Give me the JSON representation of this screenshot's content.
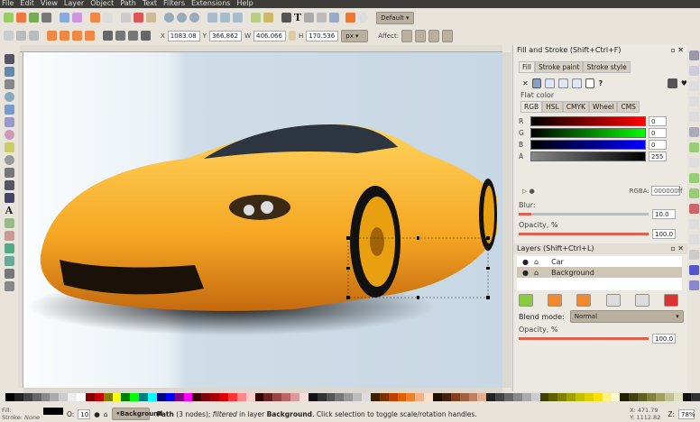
{
  "menu": [
    "File",
    "Edit",
    "View",
    "Layer",
    "Object",
    "Path",
    "Text",
    "Filters",
    "Extensions",
    "Help"
  ],
  "toolbar": {
    "preset": "Default"
  },
  "selection": {
    "x_label": "X",
    "x": "1083.08",
    "y_label": "Y",
    "y": "366.862",
    "w_label": "W",
    "w": "406.066",
    "h_label": "H",
    "h": "170.536",
    "unit": "px",
    "affect_label": "Affect:"
  },
  "fill_stroke": {
    "title": "Fill and Stroke (Shift+Ctrl+F)",
    "tabs": [
      "Fill",
      "Stroke paint",
      "Stroke style"
    ],
    "paint_type": "Flat color",
    "mode_tabs": [
      "RGB",
      "HSL",
      "CMYK",
      "Wheel",
      "CMS"
    ],
    "channels": [
      {
        "label": "R",
        "value": "0",
        "color": "#ff0000"
      },
      {
        "label": "G",
        "value": "0",
        "color": "#00ff00"
      },
      {
        "label": "B",
        "value": "0",
        "color": "#0000ff"
      },
      {
        "label": "A",
        "value": "255",
        "color": "#000000"
      }
    ],
    "rgba_label": "RGBA:",
    "rgba": "000000ff",
    "blur_label": "Blur:",
    "blur": "10.0",
    "blur_fraction": 0.1,
    "opacity_label": "Opacity, %",
    "opacity": "100.0"
  },
  "layers": {
    "title": "Layers (Shift+Ctrl+L)",
    "items": [
      {
        "name": "Car",
        "selected": false
      },
      {
        "name": "Background",
        "selected": true
      }
    ],
    "blend_label": "Blend mode:",
    "blend": "Normal",
    "opacity_label": "Opacity, %",
    "opacity": "100.0"
  },
  "status": {
    "fill_label": "Fill:",
    "stroke_label": "Stroke:",
    "stroke_value": "None",
    "fill_color": "#000000",
    "o_label": "O:",
    "opacity": "10",
    "layer": "•Background",
    "msg_obj": "Path",
    "msg_nodes": " (3 nodes); ",
    "msg_filtered": "filtered",
    "msg_in": " in layer ",
    "msg_layer": "Background",
    "msg_tail": ". Click selection to toggle scale/rotation handles.",
    "cursor_x": "X:  471.79",
    "cursor_y": "Y: 1112.82",
    "zoom_label": "Z:",
    "zoom": "78%"
  },
  "palette": [
    "#000",
    "#222",
    "#444",
    "#666",
    "#888",
    "#aaa",
    "#ccc",
    "#eee",
    "#fff",
    "#800000",
    "#c00",
    "#808000",
    "#ff0",
    "#008000",
    "#0f0",
    "#008080",
    "#0ff",
    "#000080",
    "#00f",
    "#800080",
    "#f0f",
    "#400000",
    "#800010",
    "#a00",
    "#d00",
    "#f33",
    "#f88",
    "#fcc",
    "#300",
    "#622",
    "#944",
    "#b66",
    "#d99",
    "#fdd",
    "#111",
    "#333",
    "#555",
    "#777",
    "#999",
    "#bbb",
    "#ddd",
    "#402000",
    "#803000",
    "#c04000",
    "#e06000",
    "#f08030",
    "#f8b080",
    "#fde0c8",
    "#201000",
    "#402010",
    "#804020",
    "#a06040",
    "#c08060",
    "#e0b090",
    "#222",
    "#444",
    "#666",
    "#888",
    "#aaa",
    "#ccc",
    "#404000",
    "#606000",
    "#808000",
    "#a0a000",
    "#c0c000",
    "#e0d000",
    "#ffe000",
    "#fff080",
    "#fffbd0",
    "#202000",
    "#404010",
    "#606020",
    "#808040",
    "#a0a060",
    "#c0c090",
    "#e0e0c0",
    "#111",
    "#333"
  ]
}
